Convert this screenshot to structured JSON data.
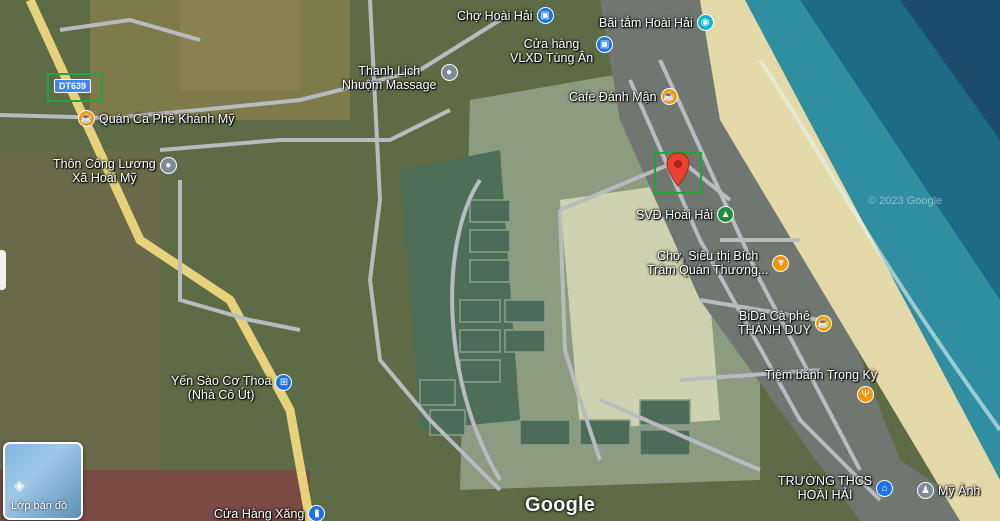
{
  "map": {
    "road_shield": "DT639",
    "copyright": "© 2023 Google",
    "logo": "Google",
    "layer_button_label": "Lớp bản đồ",
    "colors": {
      "sea": "#2f8fa0",
      "beach": "#e4d9a8",
      "road": "#b8bcc0",
      "highway": "#e6d27a"
    },
    "pois": [
      {
        "name": "Chợ Hoài Hải",
        "icon": "shopping-bag-icon",
        "color": "blue"
      },
      {
        "name": "Bãi tắm Hoài Hải",
        "icon": "camera-icon",
        "color": "teal"
      },
      {
        "name": "Cửa hàng VLXD Tùng Ân",
        "line1": "Cửa hàng",
        "line2": "VLXD Tùng Ân",
        "icon": "shopping-bag-icon",
        "color": "blue"
      },
      {
        "name": "Thanh Lịch Nhuộm Massage",
        "line1": "Thanh Lịch",
        "line2": "Nhuộm Massage",
        "icon": "pin-icon",
        "color": "grey"
      },
      {
        "name": "Cafe Đánh Mận",
        "icon": "cafe-icon",
        "color": "orange"
      },
      {
        "name": "Quán Cà Phê Khánh Mỹ",
        "icon": "cafe-icon",
        "color": "orange"
      },
      {
        "name": "Thôn Công Lương Xã Hoài Mỹ",
        "line1": "Thôn Công Lương",
        "line2": "Xã Hoài Mỹ",
        "icon": "pin-icon",
        "color": "grey"
      },
      {
        "name": "SVĐ Hoài Hải",
        "icon": "park-icon",
        "color": "green"
      },
      {
        "name": "Chợ, Siêu thị Bích Trâm Quán Thương...",
        "line1": "Chợ, Siêu thị Bích",
        "line2": "Trâm Quán Thương...",
        "icon": "cafe-icon",
        "color": "orange"
      },
      {
        "name": "BiDa Cà phê THÀNH DUY",
        "line1": "BiDa Cà phê",
        "line2": "THÀNH DUY",
        "icon": "cafe-icon",
        "color": "orange"
      },
      {
        "name": "Tiệm bánh Trọng Kỳ",
        "icon": "fork-knife-icon",
        "color": "orange"
      },
      {
        "name": "Yến Sào Cơ Thoa (Nhà Cô Út)",
        "line1": "Yến Sào Cơ Thoa",
        "line2": "(Nhà Cô Út)",
        "icon": "cart-icon",
        "color": "blue"
      },
      {
        "name": "TRƯỜNG THCS HOÀI HẢI",
        "line1": "TRƯỜNG THCS",
        "line2": "HOÀI HẢI",
        "icon": "school-icon",
        "color": "blue"
      },
      {
        "name": "Mỹ Ánh",
        "icon": "people-icon",
        "color": "grey"
      },
      {
        "name": "Cửa Hàng Xăng",
        "icon": "gas-icon",
        "color": "blue"
      }
    ]
  }
}
